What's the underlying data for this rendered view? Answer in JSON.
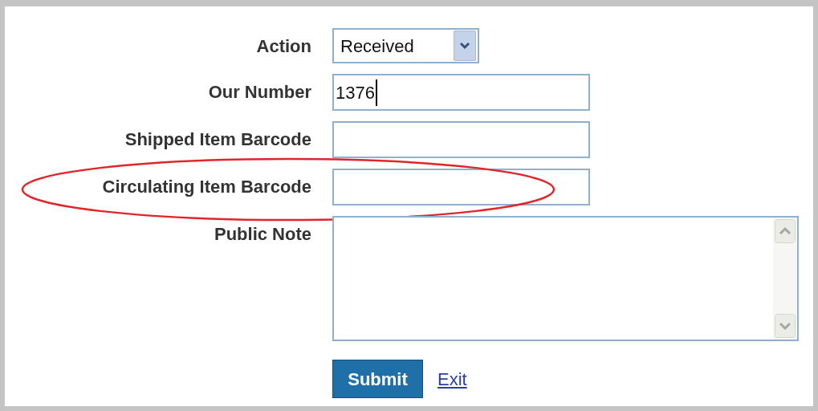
{
  "form": {
    "fields": [
      {
        "label": "Action",
        "kind": "select",
        "value": "Received",
        "highlighted": false
      },
      {
        "label": "Our Number",
        "kind": "text",
        "value": "1376",
        "highlighted": false
      },
      {
        "label": "Shipped Item Barcode",
        "kind": "text",
        "highlighted": false
      },
      {
        "label": "Circulating Item Barcode",
        "kind": "text",
        "highlighted": true
      },
      {
        "label": "Public Note",
        "kind": "textarea",
        "highlighted": false
      }
    ],
    "submit": "Submit",
    "exit": "Exit"
  }
}
